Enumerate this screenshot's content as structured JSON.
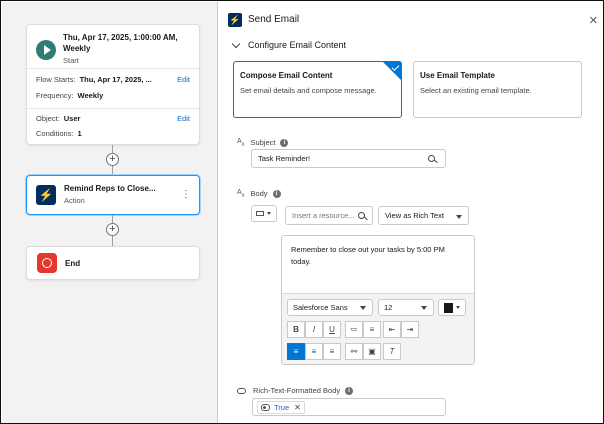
{
  "canvas": {
    "start": {
      "title_line1": "Thu, Apr 17, 2025, 1:00:00 AM,",
      "title_line2": "Weekly",
      "subtitle": "Start",
      "flow_starts_label": "Flow Starts:",
      "flow_starts_value": "Thu, Apr 17, 2025, ...",
      "edit1": "Edit",
      "frequency_label": "Frequency:",
      "frequency_value": "Weekly",
      "object_label": "Object:",
      "object_value": "User",
      "edit2": "Edit",
      "conditions_label": "Conditions:",
      "conditions_value": "1"
    },
    "action": {
      "title": "Remind Reps to Close...",
      "subtitle": "Action",
      "menu_glyph": "⋮"
    },
    "end": {
      "label": "End"
    },
    "plus_glyph": "+"
  },
  "panel": {
    "title": "Send Email",
    "close_glyph": "✕",
    "section_title": "Configure Email Content",
    "choices": [
      {
        "title": "Compose Email Content",
        "desc": "Set email details and compose message."
      },
      {
        "title": "Use Email Template",
        "desc": "Select an existing email template."
      }
    ],
    "subject": {
      "label": "Subject",
      "value": "Task Reminder!"
    },
    "body": {
      "label": "Body",
      "resource_placeholder": "Insert a resource...",
      "view_mode": "View as Rich Text",
      "content": "Remember to close out your tasks by 5:00 PM today.",
      "font_family": "Salesforce Sans",
      "font_size": "12"
    },
    "rich_text": {
      "label": "Rich-Text-Formatted Body",
      "value": "True",
      "remove_glyph": "✕"
    },
    "info_glyph": "i",
    "aa_glyph": "A",
    "aa_sub": "a"
  },
  "colors": {
    "accent": "#0176d3",
    "navy": "#032d60",
    "start_green": "#2e7d73",
    "end_red": "#e7362c"
  }
}
